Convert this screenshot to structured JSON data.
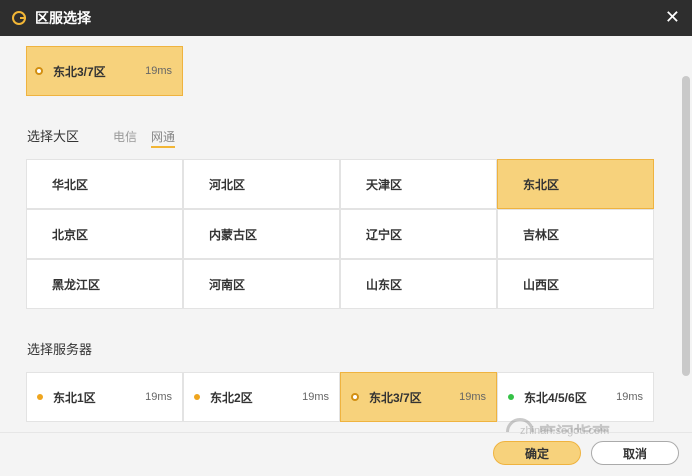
{
  "window": {
    "title": "区服选择",
    "close_symbol": "✕"
  },
  "current_selection": {
    "name": "东北3/7区",
    "ping": "19ms"
  },
  "region_section": {
    "title": "选择大区",
    "isp_tabs": [
      {
        "label": "电信",
        "active": false
      },
      {
        "label": "网通",
        "active": true
      }
    ],
    "regions": [
      {
        "label": "华北区",
        "selected": false
      },
      {
        "label": "河北区",
        "selected": false
      },
      {
        "label": "天津区",
        "selected": false
      },
      {
        "label": "东北区",
        "selected": true
      },
      {
        "label": "北京区",
        "selected": false
      },
      {
        "label": "内蒙古区",
        "selected": false
      },
      {
        "label": "辽宁区",
        "selected": false
      },
      {
        "label": "吉林区",
        "selected": false
      },
      {
        "label": "黑龙江区",
        "selected": false
      },
      {
        "label": "河南区",
        "selected": false
      },
      {
        "label": "山东区",
        "selected": false
      },
      {
        "label": "山西区",
        "selected": false
      }
    ]
  },
  "server_section": {
    "title": "选择服务器",
    "servers": [
      {
        "label": "东北1区",
        "ping": "19ms",
        "status": "orange",
        "selected": false
      },
      {
        "label": "东北2区",
        "ping": "19ms",
        "status": "orange",
        "selected": false
      },
      {
        "label": "东北3/7区",
        "ping": "19ms",
        "status": "selected",
        "selected": true
      },
      {
        "label": "东北4/5/6区",
        "ping": "19ms",
        "status": "green",
        "selected": false
      }
    ]
  },
  "footer": {
    "confirm_label": "确定",
    "cancel_label": "取消"
  },
  "watermark": {
    "text_cn": "度问指南",
    "text_en": "zhinan.sogou.com"
  },
  "colors": {
    "selected_bg": "#f7d27c",
    "selected_border": "#efb33f",
    "accent": "#f2b636"
  }
}
